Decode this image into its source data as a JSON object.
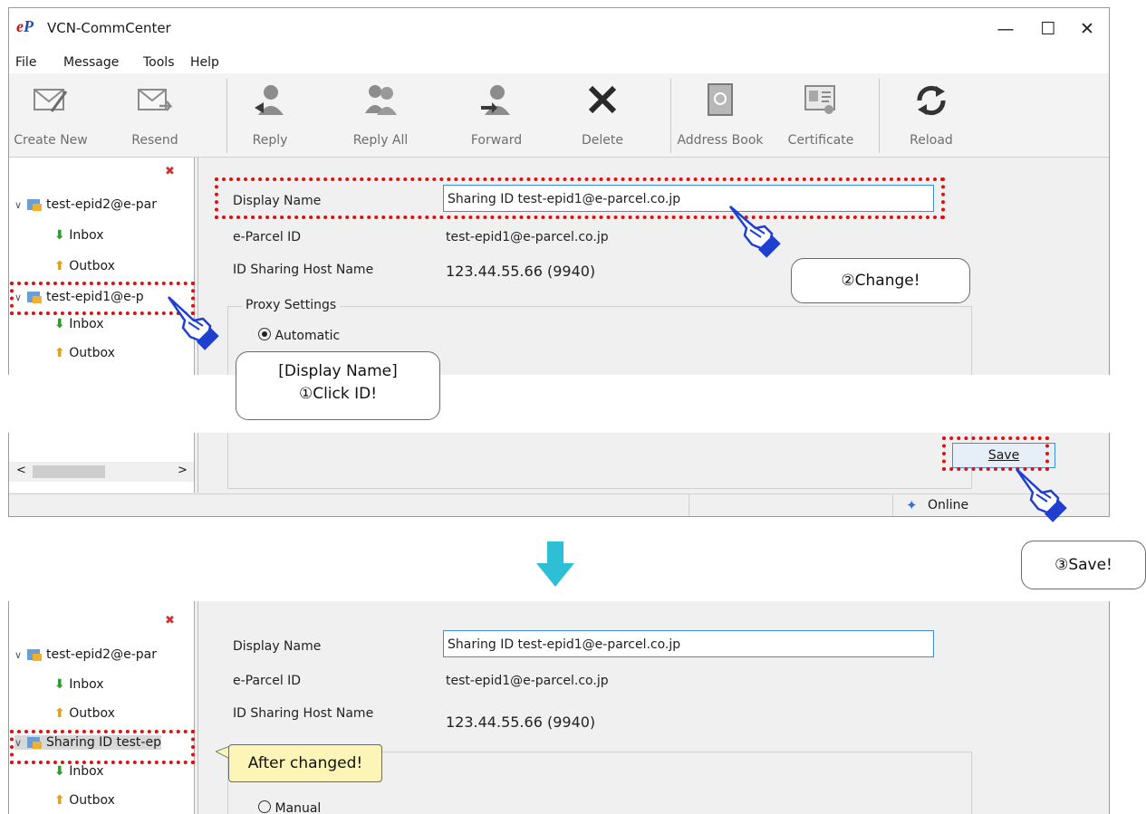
{
  "app": {
    "title": "VCN-CommCenter",
    "logo_text": "eP"
  },
  "menu": [
    "File",
    "Message",
    "Tools",
    "Help"
  ],
  "toolbar": [
    {
      "label": "Create New",
      "icon": "envelope-pen-icon"
    },
    {
      "label": "Resend",
      "icon": "envelope-arrow-icon"
    },
    {
      "label": "Reply",
      "icon": "reply-person-icon"
    },
    {
      "label": "Reply All",
      "icon": "reply-all-people-icon"
    },
    {
      "label": "Forward",
      "icon": "forward-person-icon"
    },
    {
      "label": "Delete",
      "icon": "delete-x-icon"
    },
    {
      "label": "Address Book",
      "icon": "address-book-icon"
    },
    {
      "label": "Certificate",
      "icon": "certificate-icon"
    },
    {
      "label": "Reload",
      "icon": "reload-icon"
    }
  ],
  "tree_before": {
    "account1": "test-epid2@e-par",
    "inbox1": "Inbox",
    "outbox1": "Outbox",
    "account2": "test-epid1@e-p",
    "inbox2": "Inbox",
    "outbox2": "Outbox"
  },
  "form_before": {
    "display_name_label": "Display Name",
    "display_name_value": "Sharing ID test-epid1@e-parcel.co.jp",
    "eparcel_label": "e-Parcel ID",
    "eparcel_value": "test-epid1@e-parcel.co.jp",
    "host_label": "ID Sharing Host Name",
    "host_value": "123.44.55.66 (9940)",
    "proxy_label": "Proxy Settings",
    "proxy_option": "Automatic"
  },
  "save_label": "Save",
  "status_text": "Online",
  "callouts": {
    "change": "②Change!",
    "click_line1": "[Display Name]",
    "click_line2": "①Click ID!",
    "save": "③Save!",
    "after": "After changed!"
  },
  "tree_after": {
    "account1": "test-epid2@e-par",
    "inbox1": "Inbox",
    "outbox1": "Outbox",
    "account2": "Sharing ID test-ep",
    "inbox2": "Inbox",
    "outbox2": "Outbox"
  },
  "form_after": {
    "display_name_label": "Display Name",
    "display_name_value": "Sharing ID test-epid1@e-parcel.co.jp",
    "eparcel_label": "e-Parcel ID",
    "eparcel_value": "test-epid1@e-parcel.co.jp",
    "host_label": "ID Sharing Host Name",
    "host_value": "123.44.55.66 (9940)",
    "proxy_option": "Manual"
  },
  "colors": {
    "highlight": "#e01010",
    "arrow": "#2cbfd6",
    "hand": "#1f3fcf",
    "note_yellow": "#fdf4b8",
    "input_border": "#3d8fd6"
  }
}
